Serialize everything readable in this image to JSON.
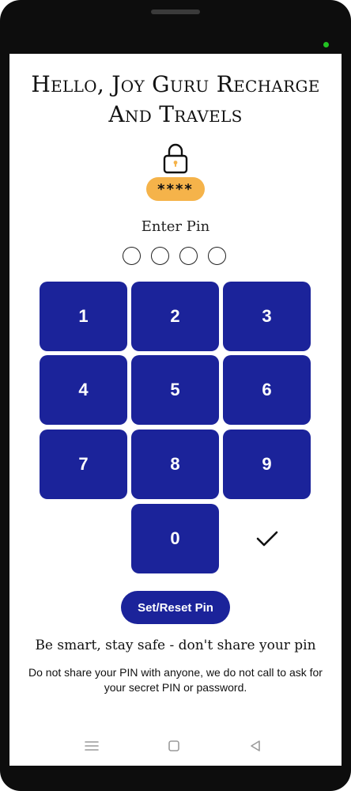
{
  "header": {
    "title": "Hello, Joy Guru Recharge And Travels"
  },
  "pin_display": {
    "mask": "****"
  },
  "pin_entry": {
    "prompt": "Enter Pin",
    "digits_entered": 0,
    "digits_total": 4
  },
  "keypad": {
    "keys": [
      "1",
      "2",
      "3",
      "4",
      "5",
      "6",
      "7",
      "8",
      "9",
      "0"
    ],
    "confirm_icon": "check-icon"
  },
  "actions": {
    "reset_label": "Set/Reset Pin"
  },
  "safety": {
    "heading": "Be smart, stay safe - don't share your pin",
    "note": "Do not share your PIN with anyone, we do not call to ask for your secret PIN or password."
  },
  "nav": {
    "icons": [
      "menu-icon",
      "home-icon",
      "back-icon"
    ]
  },
  "colors": {
    "primary": "#1b239a",
    "badge": "#f5b34a",
    "status_dot": "#22c322"
  }
}
